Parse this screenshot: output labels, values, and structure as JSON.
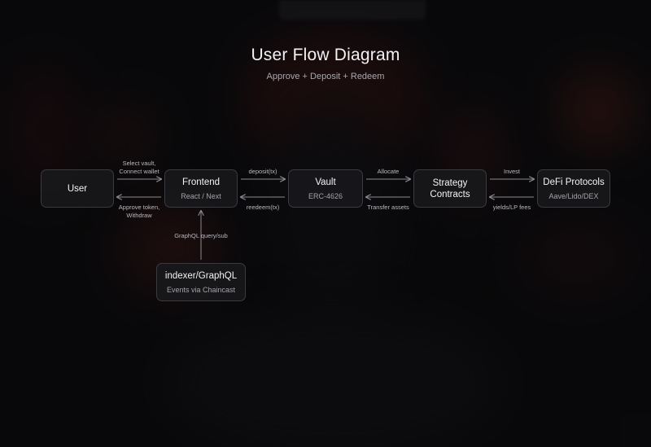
{
  "header": {
    "title": "User Flow Diagram",
    "subtitle": "Approve + Deposit + Redeem"
  },
  "nodes": {
    "user": {
      "title": "User"
    },
    "frontend": {
      "title": "Frontend",
      "subtitle": "React / Next"
    },
    "vault": {
      "title": "Vault",
      "subtitle": "ERC-4626"
    },
    "strategy": {
      "title_line1": "Strategy",
      "title_line2": "Contracts"
    },
    "defi": {
      "title": "DeFi Protocols",
      "subtitle": "Aave/Lido/DEX"
    },
    "indexer": {
      "title": "indexer/GraphQL",
      "subtitle": "Events via Chaincast"
    }
  },
  "edges": {
    "user_to_frontend": [
      "Select vault,",
      "Connect wallet"
    ],
    "frontend_to_user": [
      "Approve token,",
      "Withdraw"
    ],
    "frontend_to_vault": "deposit(tx)",
    "vault_to_frontend": "reedeem(tx)",
    "vault_to_strategy": "Allocate",
    "strategy_to_vault": "Transfer assets",
    "strategy_to_defi": "Invest",
    "defi_to_strategy": "yields/LP fees",
    "indexer_to_frontend": "GraphQL query/sub"
  },
  "colors": {
    "background": "#0b0b0d",
    "node_fill": "#18181b",
    "node_border": "#3a3a40",
    "arrow": "#8a8a92",
    "text": "#f4f4f6",
    "muted_text": "#a3a3ab"
  }
}
